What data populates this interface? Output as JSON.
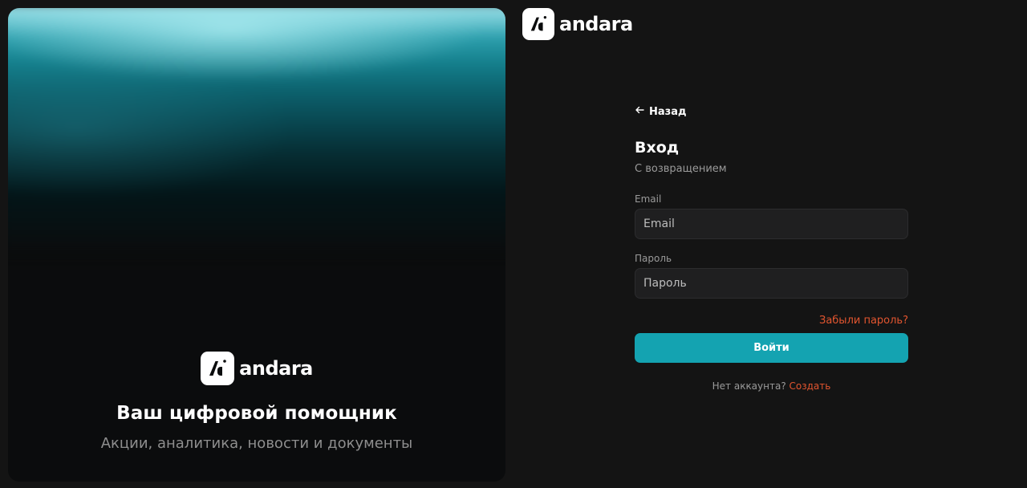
{
  "brand": {
    "name": "andara",
    "logo_icon": "andara-logo-icon",
    "logo_bg": "#ffffff"
  },
  "hero": {
    "title": "Ваш цифровой помощник",
    "subtitle": "Акции, аналитика, новости и документы"
  },
  "form": {
    "back_label": "Назад",
    "title": "Вход",
    "subtitle": "С возвращением",
    "email_label": "Email",
    "email_placeholder": "Email",
    "password_label": "Пароль",
    "password_placeholder": "Пароль",
    "forgot_label": "Забыли пароль?",
    "submit_label": "Войти",
    "no_account_text": "Нет аккаунта?",
    "create_label": "Создать"
  },
  "colors": {
    "accent": "#14a3b1",
    "link": "#e2552f",
    "background": "#141414",
    "input_bg": "#1f1f20"
  }
}
